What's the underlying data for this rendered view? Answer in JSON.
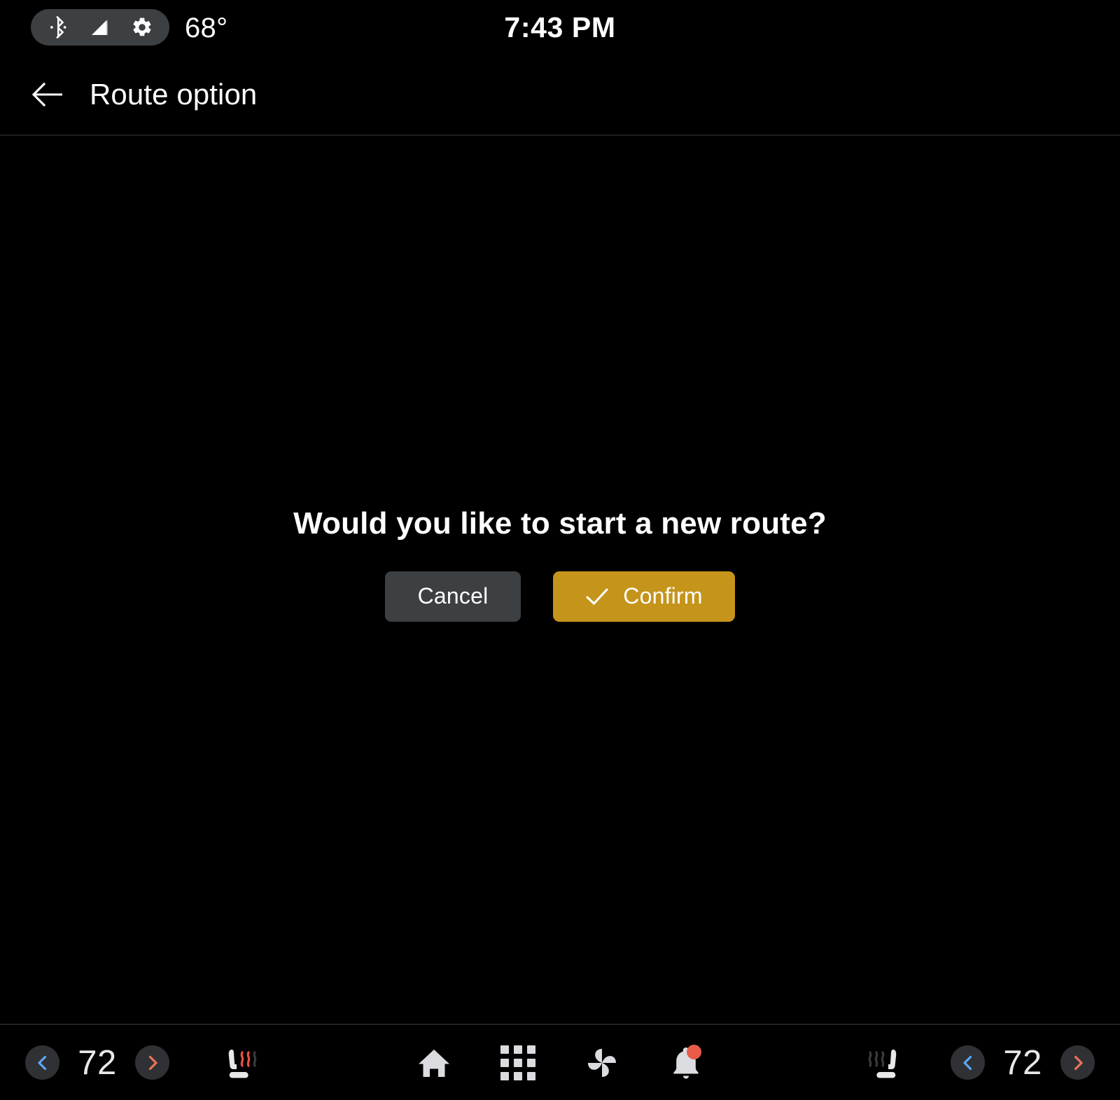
{
  "status_bar": {
    "icons": [
      {
        "name": "bluetooth-icon",
        "label": "Bluetooth"
      },
      {
        "name": "signal-strength-icon",
        "label": "Cellular signal"
      },
      {
        "name": "gear-icon",
        "label": "Settings"
      }
    ],
    "outside_temperature": "68°",
    "clock": "7:43 PM"
  },
  "app_bar": {
    "back_label": "Back",
    "title": "Route option"
  },
  "dialog": {
    "message": "Would you like to start a new route?",
    "cancel_label": "Cancel",
    "confirm_label": "Confirm"
  },
  "nav_bar": {
    "driver_climate": {
      "decrease_label": "Decrease driver temperature",
      "temperature": "72",
      "increase_label": "Increase driver temperature",
      "seat_heater_label": "Driver seat heater",
      "seat_heater_level": 2
    },
    "passenger_climate": {
      "seat_heater_label": "Passenger seat heater",
      "seat_heater_level": 0,
      "decrease_label": "Decrease passenger temperature",
      "temperature": "72",
      "increase_label": "Increase passenger temperature"
    },
    "center_items": [
      {
        "name": "home-icon",
        "label": "Home"
      },
      {
        "name": "apps-grid-icon",
        "label": "Apps"
      },
      {
        "name": "fan-icon",
        "label": "Climate"
      },
      {
        "name": "bell-icon",
        "label": "Notifications",
        "badge": true
      }
    ]
  },
  "colors": {
    "background": "#000000",
    "surface": "#3c4043",
    "confirm_accent": "#c5941b",
    "cool_chevron": "#5ba7f0",
    "warm_chevron": "#e8735a",
    "notification_badge": "#ea5c47",
    "heat_active": "#e8513f",
    "heat_inactive": "#3a3a3a",
    "text_primary": "#ffffff"
  }
}
